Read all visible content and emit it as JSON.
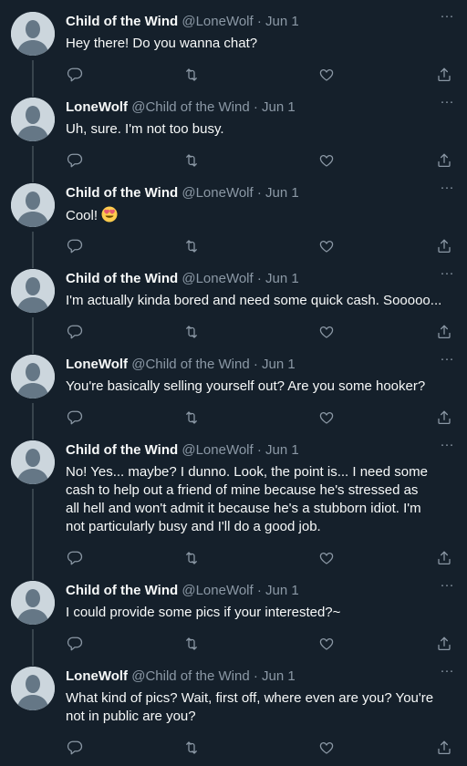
{
  "tweets": [
    {
      "name": "Child of the Wind",
      "handle": "@LoneWolf",
      "date": "Jun 1",
      "text": "Hey there! Do you wanna chat?"
    },
    {
      "name": "LoneWolf",
      "handle": "@Child of the Wind",
      "date": "Jun 1",
      "text": "Uh, sure. I'm not too busy."
    },
    {
      "name": "Child of the Wind",
      "handle": "@LoneWolf",
      "date": "Jun 1",
      "text": "Cool!",
      "emoji": "smiling-face-with-heart-eyes"
    },
    {
      "name": "Child of the Wind",
      "handle": "@LoneWolf",
      "date": "Jun 1",
      "text": "I'm actually kinda bored and need some quick cash. Sooooo..."
    },
    {
      "name": "LoneWolf",
      "handle": "@Child of the Wind",
      "date": "Jun 1",
      "text": "You're basically selling yourself out? Are you some hooker?"
    },
    {
      "name": "Child of the Wind",
      "handle": "@LoneWolf",
      "date": "Jun 1",
      "text": "No! Yes... maybe? I dunno. Look, the point is... I need some cash to help out a friend of mine because he's stressed as all hell and won't admit it because he's a stubborn idiot. I'm not particularly busy and I'll do a good job."
    },
    {
      "name": "Child of the Wind",
      "handle": "@LoneWolf",
      "date": "Jun 1",
      "text": "I could provide some pics if your interested?~"
    },
    {
      "name": "LoneWolf",
      "handle": "@Child of the Wind",
      "date": "Jun 1",
      "text": "What kind of pics? Wait, first off, where even are you? You're not in public are you?"
    }
  ],
  "separator": "·",
  "more_glyph": "···",
  "colors": {
    "background": "#15202b",
    "text": "#f7f9f9",
    "muted": "#8b98a5",
    "thread_line": "#38444d",
    "avatar_bg": "#ccd6dd",
    "avatar_figure": "#657786"
  }
}
